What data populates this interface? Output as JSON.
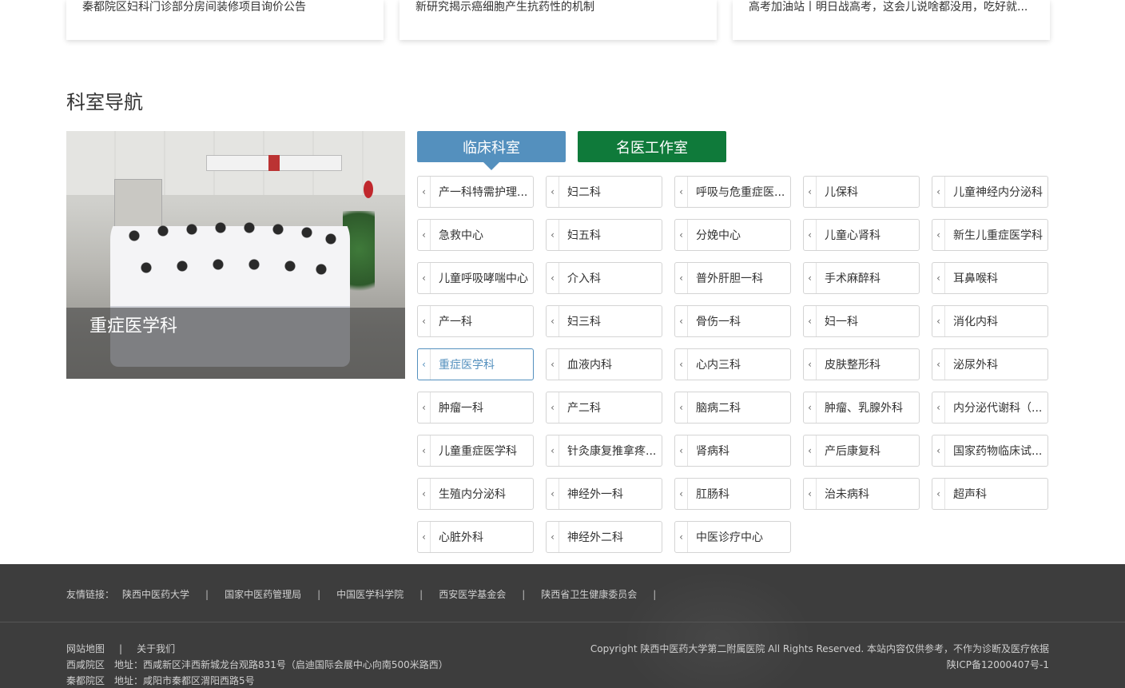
{
  "news": [
    "秦都院区妇科门诊部分房间装修项目询价公告",
    "新研究揭示癌细胞产生抗药性的机制",
    "高考加油站丨明日战高考，这会儿说啥都没用，吃好就..."
  ],
  "section_title": "科室导航",
  "feature": {
    "caption": "重症医学科"
  },
  "tabs": [
    "临床科室",
    "名医工作室"
  ],
  "departments": [
    [
      "产一科特需护理...",
      "妇二科",
      "呼吸与危重症医...",
      "儿保科",
      "儿童神经内分泌科"
    ],
    [
      "急救中心",
      "妇五科",
      "分娩中心",
      "儿童心肾科",
      "新生儿重症医学科"
    ],
    [
      "儿童呼吸哮喘中心",
      "介入科",
      "普外肝胆一科",
      "手术麻醉科",
      "耳鼻喉科"
    ],
    [
      "产一科",
      "妇三科",
      "骨伤一科",
      "妇一科",
      "消化内科"
    ],
    [
      "重症医学科",
      "血液内科",
      "心内三科",
      "皮肤整形科",
      "泌尿外科"
    ],
    [
      "肿瘤一科",
      "产二科",
      "脑病二科",
      "肿瘤、乳腺外科",
      "内分泌代谢科（..."
    ],
    [
      "儿童重症医学科",
      "针灸康复推拿疼...",
      "肾病科",
      "产后康复科",
      "国家药物临床试..."
    ],
    [
      "生殖内分泌科",
      "神经外一科",
      "肛肠科",
      "治未病科",
      "超声科"
    ],
    [
      "心脏外科",
      "神经外二科",
      "中医诊疗中心"
    ]
  ],
  "active_department": "重症医学科",
  "footer": {
    "links_label": "友情链接：",
    "links": [
      "陕西中医药大学",
      "国家中医药管理局",
      "中国医学科学院",
      "西安医学基金会",
      "陕西省卫生健康委员会"
    ],
    "sitemap": "网站地图",
    "about": "关于我们",
    "address1": "西咸院区　地址：西咸新区沣西新城龙台观路831号（启迪国际会展中心向南500米路西）",
    "address2": "秦都院区　地址：咸阳市秦都区渭阳西路5号",
    "copyright": "Copyright 陕西中医药大学第二附属医院 All Rights Reserved. 本站内容仅供参考，不作为诊断及医疗依据",
    "icp": "陕ICP备12000407号-1"
  },
  "icons": {
    "dept_chevron": "chevron-left-icon"
  },
  "colors": {
    "tab_primary": "#5490be",
    "tab_secondary": "#0f7a3a",
    "footer_bg": "#3d3d3d"
  }
}
